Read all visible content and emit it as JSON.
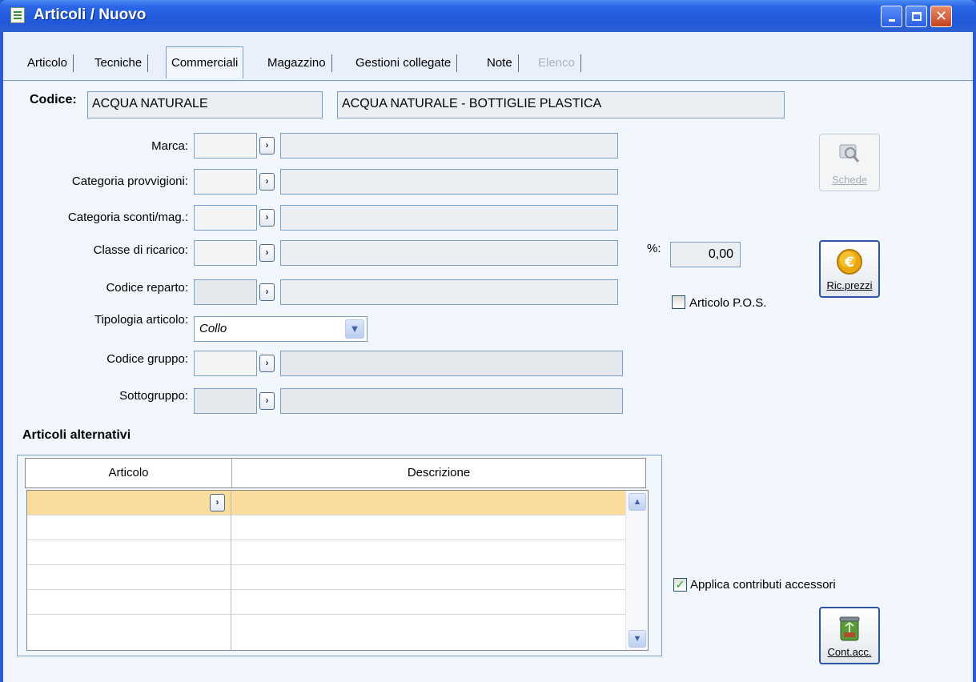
{
  "window": {
    "title": "Articoli / Nuovo"
  },
  "tabs": [
    {
      "label": "Articolo"
    },
    {
      "label": "Tecniche"
    },
    {
      "label": "Commerciali"
    },
    {
      "label": "Magazzino"
    },
    {
      "label": "Gestioni collegate"
    },
    {
      "label": "Note"
    },
    {
      "label": "Elenco"
    }
  ],
  "header": {
    "code_label": "Codice:",
    "code_value": "ACQUA NATURALE",
    "description_value": "ACQUA NATURALE - BOTTIGLIE PLASTICA"
  },
  "fields": {
    "marca_label": "Marca:",
    "categoria_provvigioni_label": "Categoria provvigioni:",
    "categoria_sconti_label": "Categoria sconti/mag.:",
    "classe_ricarico_label": "Classe di ricarico:",
    "codice_reparto_label": "Codice reparto:",
    "tipologia_label": "Tipologia articolo:",
    "tipologia_value": "Collo",
    "codice_gruppo_label": "Codice gruppo:",
    "sottogruppo_label": "Sottogruppo:",
    "percent_label": "%:",
    "percent_value": "0,00"
  },
  "checks": {
    "articolo_pos_label": "Articolo P.O.S.",
    "applica_contributi_label": "Applica contributi accessori"
  },
  "buttons": {
    "schede": "Schede",
    "ric_prezzi": "Ric.prezzi",
    "cont_acc": "Cont.acc."
  },
  "alternatives": {
    "title": "Articoli alternativi",
    "columns": [
      "Articolo",
      "Descrizione"
    ]
  },
  "icons": {
    "zoom": "chevron-right-icon",
    "combo": "chevron-down-icon"
  },
  "colors": {
    "titlebar": "#2a66e6",
    "selected_row": "#fadd9c",
    "field_border": "#7aa0c9"
  }
}
